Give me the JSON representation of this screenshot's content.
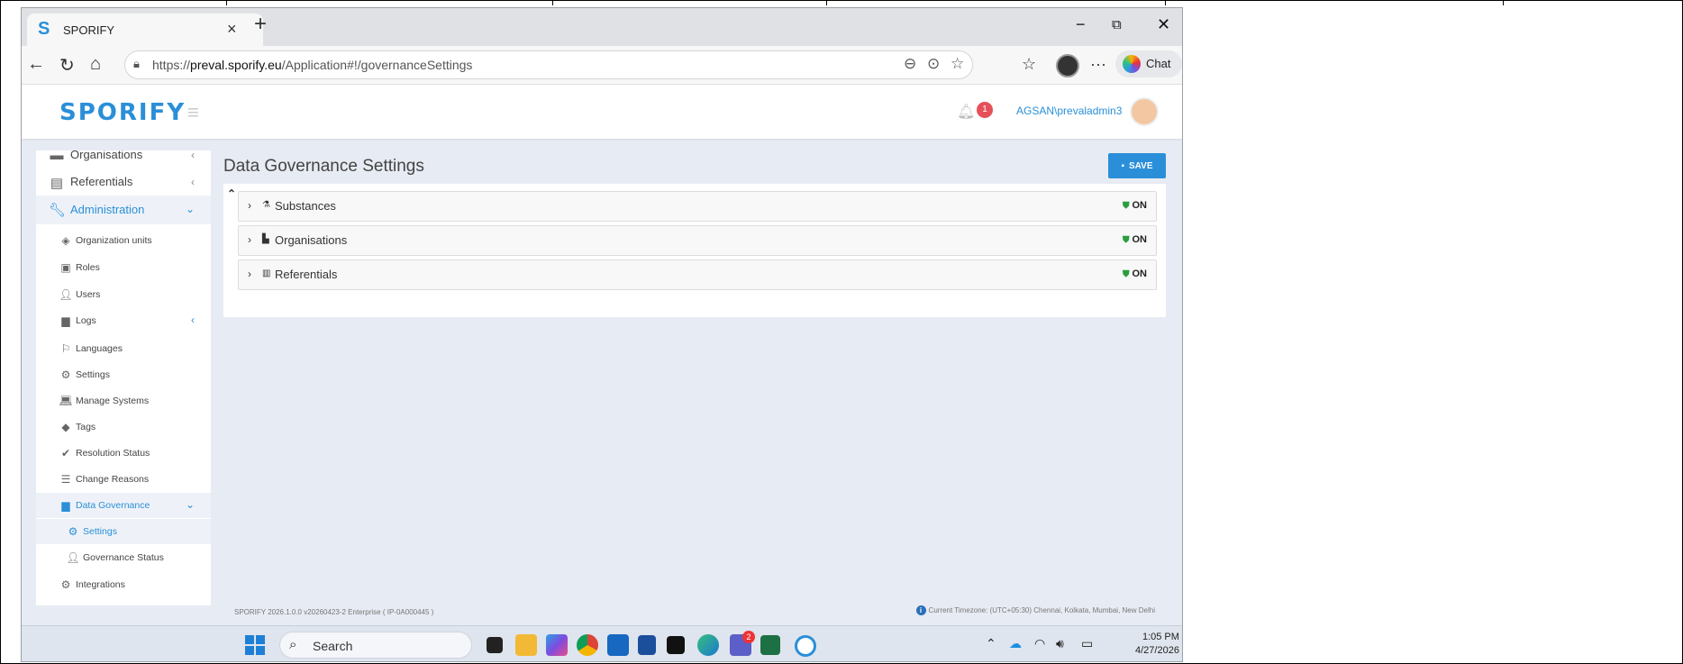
{
  "browser": {
    "tab_title": "SPORIFY",
    "url_prefix": "https://",
    "url_domain": "preval.sporify.eu",
    "url_path": "/Application#!/governanceSettings",
    "chat_label": "Chat"
  },
  "app": {
    "logo": "SPORIFY",
    "notification_count": "1",
    "user_name": "AGSAN\\prevaladmin3"
  },
  "sidebar": {
    "items": [
      {
        "label": "Organisations",
        "icon": "organisations-icon"
      },
      {
        "label": "Referentials",
        "icon": "referentials-icon"
      },
      {
        "label": "Administration",
        "icon": "wrench-icon"
      },
      {
        "label": "Organization units",
        "icon": "layers-icon"
      },
      {
        "label": "Roles",
        "icon": "roles-icon"
      },
      {
        "label": "Users",
        "icon": "users-icon"
      },
      {
        "label": "Logs",
        "icon": "logs-icon"
      },
      {
        "label": "Languages",
        "icon": "flag-icon"
      },
      {
        "label": "Settings",
        "icon": "gear-icon"
      },
      {
        "label": "Manage Systems",
        "icon": "laptop-icon"
      },
      {
        "label": "Tags",
        "icon": "tags-icon"
      },
      {
        "label": "Resolution Status",
        "icon": "check-icon"
      },
      {
        "label": "Change Reasons",
        "icon": "list-icon"
      },
      {
        "label": "Data Governance",
        "icon": "governance-icon"
      },
      {
        "label": "Settings",
        "icon": "gear-icon"
      },
      {
        "label": "Governance Status",
        "icon": "user-icon"
      },
      {
        "label": "Integrations",
        "icon": "cogs-icon"
      }
    ]
  },
  "main": {
    "title": "Data Governance Settings",
    "save_label": "SAVE",
    "rows": [
      {
        "label": "Substances",
        "status": "ON"
      },
      {
        "label": "Organisations",
        "status": "ON"
      },
      {
        "label": "Referentials",
        "status": "ON"
      }
    ]
  },
  "footer": {
    "version": "SPORIFY 2026.1.0.0 v20260423-2 Enterprise ( IP-0A000445 )",
    "timezone": "Current Timezone: (UTC+05:30) Chennai, Kolkata, Mumbai, New Delhi"
  },
  "taskbar": {
    "search_label": "Search",
    "teams_badge": "2",
    "time": "1:05 PM",
    "date": "4/27/2026"
  },
  "colors": {
    "accent": "#2a8fd8",
    "badge": "#e6505a",
    "status_on": "#2a9d3e"
  }
}
